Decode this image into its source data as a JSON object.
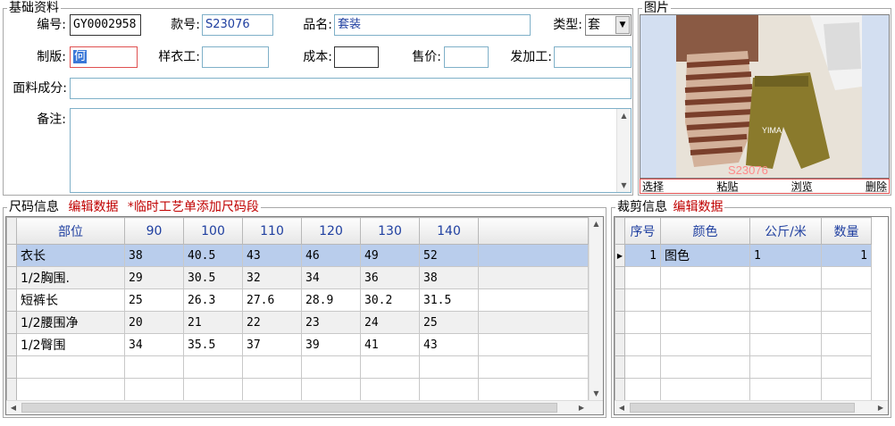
{
  "basic": {
    "legend": "基础资料",
    "labels": {
      "code": "编号:",
      "style_no": "款号:",
      "product_name": "品名:",
      "type": "类型:",
      "pattern": "制版:",
      "sample_worker": "样衣工:",
      "cost": "成本:",
      "price": "售价:",
      "processor": "发加工:",
      "fabric": "面料成分:",
      "remark": "备注:"
    },
    "values": {
      "code": "GY0002958",
      "style_no": "S23076",
      "product_name": "套装",
      "type": "套",
      "pattern": "何",
      "sample_worker": "",
      "cost": "",
      "price": "",
      "processor": "",
      "fabric": "",
      "remark": ""
    }
  },
  "image": {
    "legend": "图片",
    "overlay_text": "S23076",
    "brand_text": "YIMA",
    "buttons": {
      "select": "选择",
      "paste": "粘贴",
      "browse": "浏览",
      "delete": "删除"
    }
  },
  "size": {
    "legend": "尺码信息",
    "edit": "编辑数据",
    "note": "*临时工艺单添加尺码段",
    "columns": [
      "部位",
      "90",
      "100",
      "110",
      "120",
      "130",
      "140"
    ],
    "rows": [
      [
        "衣长",
        "38",
        "40.5",
        "43",
        "46",
        "49",
        "52"
      ],
      [
        "1/2胸围.",
        "29",
        "30.5",
        "32",
        "34",
        "36",
        "38"
      ],
      [
        "短裤长",
        "25",
        "26.3",
        "27.6",
        "28.9",
        "30.2",
        "31.5"
      ],
      [
        "1/2腰围净",
        "20",
        "21",
        "22",
        "23",
        "24",
        "25"
      ],
      [
        "1/2臀围",
        "34",
        "35.5",
        "37",
        "39",
        "41",
        "43"
      ]
    ]
  },
  "cut": {
    "legend": "裁剪信息",
    "edit": "编辑数据",
    "columns": [
      "序号",
      "颜色",
      "公斤/米",
      "数量"
    ],
    "rows": [
      [
        "1",
        "图色",
        "1",
        "1"
      ]
    ]
  },
  "colors": {
    "accent_red": "#c00000",
    "header_blue": "#1f3fa0",
    "selected_row": "#b9cdec"
  }
}
